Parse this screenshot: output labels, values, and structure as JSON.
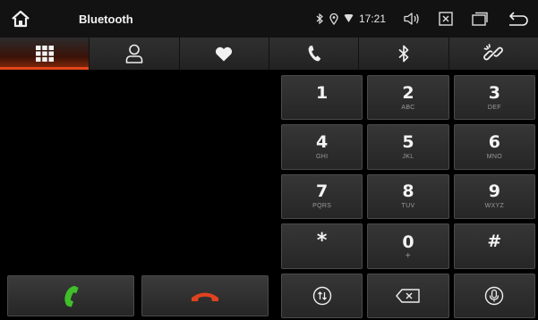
{
  "status_bar": {
    "title": "Bluetooth",
    "time": "17:21",
    "icons": [
      "home-icon",
      "bluetooth-small-icon",
      "location-icon",
      "wifi-icon",
      "volume-icon",
      "close-box-icon",
      "window-icon",
      "back-icon"
    ]
  },
  "tabs": [
    {
      "name": "dialpad",
      "icon": "dialpad-grid-icon",
      "active": true
    },
    {
      "name": "contacts",
      "icon": "person-icon",
      "active": false
    },
    {
      "name": "favorites",
      "icon": "heart-icon",
      "active": false
    },
    {
      "name": "call-log",
      "icon": "phone-icon",
      "active": false
    },
    {
      "name": "bluetooth",
      "icon": "bluetooth-icon",
      "active": false
    },
    {
      "name": "pairing",
      "icon": "link-icon",
      "active": false
    }
  ],
  "keypad": {
    "keys": [
      {
        "digit": "1",
        "letters": ""
      },
      {
        "digit": "2",
        "letters": "ABC"
      },
      {
        "digit": "3",
        "letters": "DEF"
      },
      {
        "digit": "4",
        "letters": "GHI"
      },
      {
        "digit": "5",
        "letters": "JKL"
      },
      {
        "digit": "6",
        "letters": "MNO"
      },
      {
        "digit": "7",
        "letters": "PQRS"
      },
      {
        "digit": "8",
        "letters": "TUV"
      },
      {
        "digit": "9",
        "letters": "WXYZ"
      },
      {
        "digit": "*",
        "letters": ""
      },
      {
        "digit": "0",
        "letters": "+"
      },
      {
        "digit": "#",
        "letters": ""
      }
    ],
    "function_keys": [
      "transfer-icon",
      "backspace-icon",
      "microphone-icon"
    ]
  },
  "colors": {
    "accept": "#3fbf2a",
    "reject": "#e0421f",
    "active_tab": "#e2471a"
  }
}
